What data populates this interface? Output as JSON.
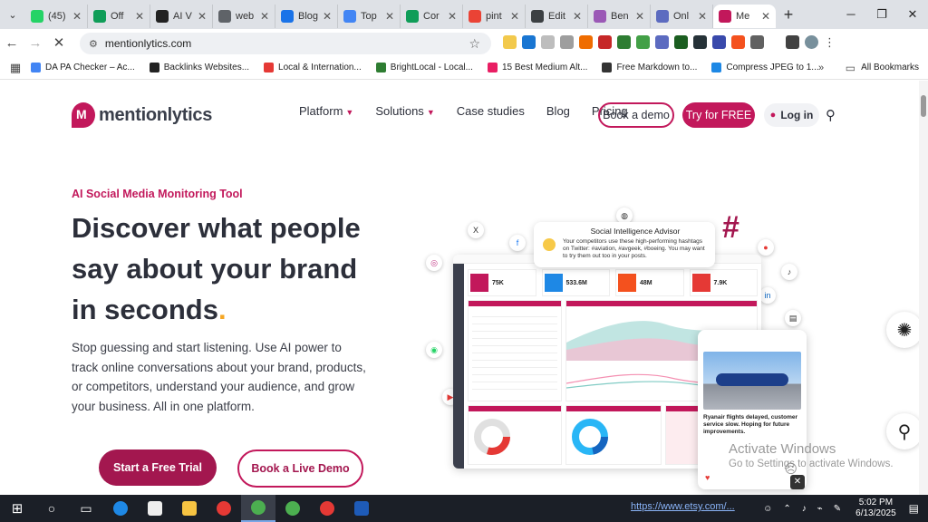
{
  "browser": {
    "tabs": [
      {
        "label": "(45)",
        "color": "#25d366"
      },
      {
        "label": "Off",
        "color": "#0f9d58"
      },
      {
        "label": "AI V",
        "color": "#222222"
      },
      {
        "label": "web",
        "color": "#5f6368"
      },
      {
        "label": "Blog",
        "color": "#1a73e8"
      },
      {
        "label": "Top",
        "color": "#4285f4"
      },
      {
        "label": "Cor",
        "color": "#0f9d58"
      },
      {
        "label": "pint",
        "color": "#ea4335"
      },
      {
        "label": "Edit",
        "color": "#3c4043"
      },
      {
        "label": "Ben",
        "color": "#9b59b6"
      },
      {
        "label": "Onl",
        "color": "#5c6bc0"
      },
      {
        "label": "Me",
        "color": "#c2185b",
        "active": true
      }
    ],
    "url": "mentionlytics.com",
    "bookmarks": [
      {
        "label": "DA PA Checker – Ac...",
        "color": "#4285f4"
      },
      {
        "label": "Backlinks Websites...",
        "color": "#222222"
      },
      {
        "label": "Local & Internation...",
        "color": "#e53935"
      },
      {
        "label": "BrightLocal - Local...",
        "color": "#2e7d32"
      },
      {
        "label": "15 Best Medium Alt...",
        "color": "#e91e63"
      },
      {
        "label": "Free Markdown to...",
        "color": "#333333"
      },
      {
        "label": "Compress JPEG to 1...",
        "color": "#1e88e5"
      }
    ],
    "all_bookmarks": "All Bookmarks"
  },
  "site": {
    "brand": "mentionlytics",
    "nav": {
      "platform": "Platform",
      "solutions": "Solutions",
      "case_studies": "Case studies",
      "blog": "Blog",
      "pricing": "Pricing",
      "book_demo": "Book a demo",
      "try_free": "Try for FREE",
      "login": "Log in"
    },
    "hero": {
      "eyebrow": "AI Social Media Monitoring Tool",
      "headline": "Discover what people say about your brand in seconds",
      "headline_dot": ".",
      "description": "Stop guessing and start listening. Use AI power to track online conversations about your brand, products, or competitors, understand your audience, and grow your business. All in one platform.",
      "cta_primary": "Start a Free Trial",
      "cta_secondary": "Book a Live Demo"
    },
    "illustration": {
      "advisor_title": "Social Intelligence Advisor",
      "advisor_body": "Your competitors use these high-performing hashtags on Twitter: #aviation, #avgeek, #boeing. You may want to try them out too in your posts.",
      "post_caption": "Ryanair flights delayed, customer service slow. Hoping for future improvements.",
      "kpis": [
        "75K",
        "533.6M",
        "48M",
        "7.9K"
      ]
    },
    "watermark": {
      "line1": "Activate Windows",
      "line2": "Go to Settings to activate Windows."
    }
  },
  "taskbar": {
    "time": "5:02 PM",
    "date": "6/13/2025",
    "status_url": "https://www.etsy.com/..."
  },
  "colors": {
    "brand": "#c2185b",
    "brand_dark": "#a3174f",
    "accent": "#f5a623"
  }
}
